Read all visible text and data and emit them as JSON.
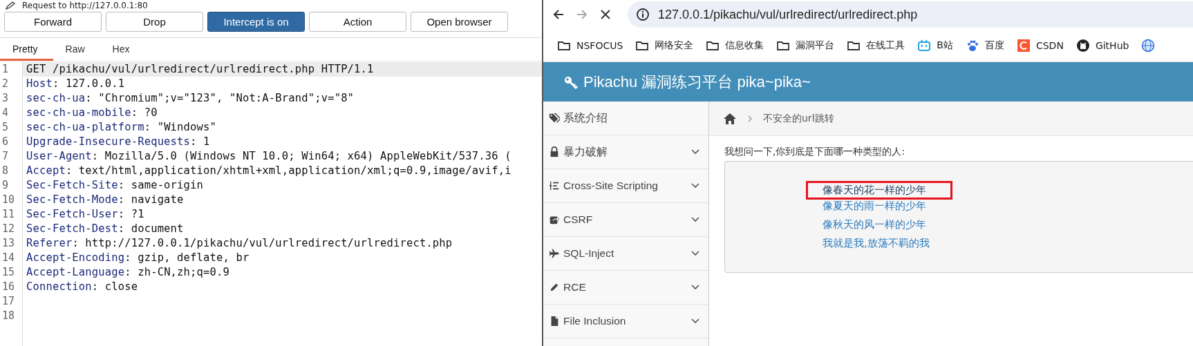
{
  "proxy": {
    "title": "Request to http://127.0.0.1:80",
    "buttons": [
      {
        "label": "Forward",
        "on": false
      },
      {
        "label": "Drop",
        "on": false
      },
      {
        "label": "Intercept is on",
        "on": true
      },
      {
        "label": "Action",
        "on": false
      },
      {
        "label": "Open browser",
        "on": false
      }
    ],
    "tabs": [
      {
        "label": "Pretty",
        "selected": true
      },
      {
        "label": "Raw",
        "selected": false
      },
      {
        "label": "Hex",
        "selected": false
      }
    ],
    "lines": [
      {
        "number": "1",
        "text": "GET /pikachu/vul/urlredirect/urlredirect.php HTTP/1.1",
        "highlighted": true
      },
      {
        "number": "2",
        "name": "Host",
        "value": ": 127.0.0.1",
        "highlighted": false
      },
      {
        "number": "3",
        "name": "sec-ch-ua",
        "value": ": \"Chromium\";v=\"123\", \"Not:A-Brand\";v=\"8\"",
        "highlighted": false
      },
      {
        "number": "4",
        "name": "sec-ch-ua-mobile",
        "value": ": ?0",
        "highlighted": false
      },
      {
        "number": "5",
        "name": "sec-ch-ua-platform",
        "value": ": \"Windows\"",
        "highlighted": false
      },
      {
        "number": "6",
        "name": "Upgrade-Insecure-Requests",
        "value": ": 1",
        "highlighted": false
      },
      {
        "number": "7",
        "name": "User-Agent",
        "value": ": Mozilla/5.0 (Windows NT 10.0; Win64; x64) AppleWebKit/537.36 (",
        "highlighted": false
      },
      {
        "number": "8",
        "name": "Accept",
        "value": ": text/html,application/xhtml+xml,application/xml;q=0.9,image/avif,i",
        "highlighted": false
      },
      {
        "number": "9",
        "name": "Sec-Fetch-Site",
        "value": ": same-origin",
        "highlighted": false
      },
      {
        "number": "10",
        "name": "Sec-Fetch-Mode",
        "value": ": navigate",
        "highlighted": false
      },
      {
        "number": "11",
        "name": "Sec-Fetch-User",
        "value": ": ?1",
        "highlighted": false
      },
      {
        "number": "12",
        "name": "Sec-Fetch-Dest",
        "value": ": document",
        "highlighted": false
      },
      {
        "number": "13",
        "name": "Referer",
        "value": ": http://127.0.0.1/pikachu/vul/urlredirect/urlredirect.php",
        "highlighted": false
      },
      {
        "number": "14",
        "name": "Accept-Encoding",
        "value": ": gzip, deflate, br",
        "highlighted": false
      },
      {
        "number": "15",
        "name": "Accept-Language",
        "value": ": zh-CN,zh;q=0.9",
        "highlighted": false
      },
      {
        "number": "16",
        "name": "Connection",
        "value": ": close",
        "highlighted": false
      },
      {
        "number": "17",
        "highlighted": false
      },
      {
        "number": "18",
        "highlighted": false
      }
    ]
  },
  "browser": {
    "back_enabled": true,
    "forward_enabled": false,
    "url": "127.0.0.1/pikachu/vul/urlredirect/urlredirect.php",
    "bookmarks": [
      {
        "kind": "folder",
        "label": "NSFOCUS"
      },
      {
        "kind": "folder",
        "label": "网络安全"
      },
      {
        "kind": "folder",
        "label": "信息收集"
      },
      {
        "kind": "folder",
        "label": "漏洞平台"
      },
      {
        "kind": "folder",
        "label": "在线工具"
      },
      {
        "kind": "tv",
        "label": "B站"
      },
      {
        "kind": "paw",
        "label": "百度"
      },
      {
        "kind": "c",
        "label": "CSDN"
      },
      {
        "kind": "cat",
        "label": "GitHub"
      },
      {
        "kind": "globe"
      }
    ]
  },
  "page": {
    "title": "Pikachu 漏洞练习平台 pika~pika~",
    "sidebar": [
      {
        "label": "系统介绍",
        "expandable": false
      },
      {
        "label": "暴力破解",
        "expandable": true
      },
      {
        "label": "Cross-Site Scripting",
        "expandable": true
      },
      {
        "label": "CSRF",
        "expandable": true
      },
      {
        "label": "SQL-Inject",
        "expandable": true
      },
      {
        "label": "RCE",
        "expandable": true
      },
      {
        "label": "File Inclusion",
        "expandable": true
      }
    ],
    "breadcrumb": "不安全的url跳转",
    "question": "我想问一下,你到底是下面哪一种类型的人:",
    "options": [
      {
        "label": "像春天的花一样的少年",
        "marked": true
      },
      {
        "label": "像夏天的雨一样的少年",
        "marked": false
      },
      {
        "label": "像秋天的风一样的少年",
        "marked": false
      },
      {
        "label": "我就是我,放荡不羁的我",
        "marked": false
      }
    ]
  }
}
